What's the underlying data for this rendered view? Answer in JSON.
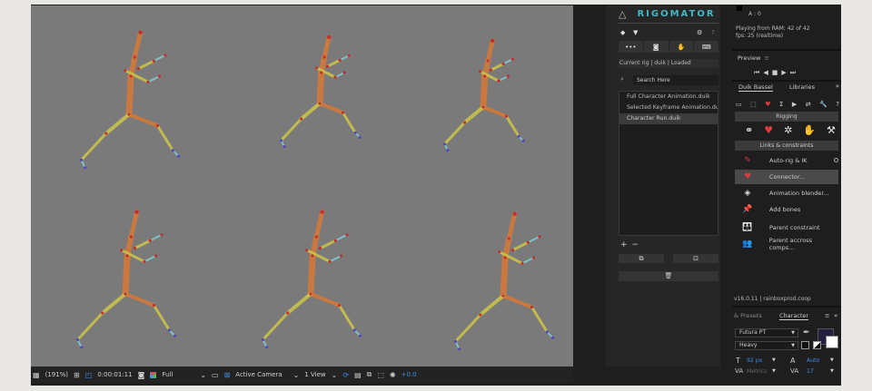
{
  "viewer": {
    "bg_color": "#7a7a7a",
    "status_bar": {
      "zoom": "(191%)",
      "timecode": "0:00:01:11",
      "resolution": "Full",
      "camera": "Active Camera",
      "view": "1 View",
      "exposure": "+0.0"
    }
  },
  "rigomator": {
    "title": "RIGOMATOR",
    "status": "Current rig | duik | Loaded",
    "search_placeholder": "Search Here",
    "items": [
      {
        "label": "Full Character Animation.duik",
        "active": false
      },
      {
        "label": "Selected Keyframe Animation.duik",
        "active": false
      },
      {
        "label": "Character Run.duik",
        "active": true
      }
    ],
    "add_label": "+",
    "remove_label": "−"
  },
  "duik_panel": {
    "alpha_line": "A : 0",
    "ram_status": "Playing from RAM: 42 of 42",
    "fps_status": "fps: 25 (realtime)",
    "preview_title": "Preview",
    "preview_menu": "≡",
    "tabs": [
      {
        "label": "Duik Bassel",
        "active": true
      },
      {
        "label": "Libraries",
        "active": false
      }
    ],
    "sections": {
      "rigging": "Rigging",
      "links": "Links & constraints"
    },
    "tools": [
      {
        "label": "Auto-rig & IK",
        "icon": "auto-rig-icon"
      },
      {
        "label": "Connector...",
        "icon": "connector-icon",
        "selected": true
      },
      {
        "label": "Animation blender...",
        "icon": "animation-blender-icon"
      },
      {
        "label": "Add bones",
        "icon": "pin-icon"
      },
      {
        "label": "Parent constraint",
        "icon": "parent-constraint-icon"
      },
      {
        "label": "Parent accross comps...",
        "icon": "parent-across-icon"
      }
    ],
    "version": "v16.0.11 | rainboxprod.coop",
    "char_tabs": {
      "presets": "& Presets",
      "character": "Character"
    },
    "font_name": "Futura PT",
    "font_style": "Heavy",
    "font_size": "92 px",
    "leading": "Auto",
    "kerning": "Metrics",
    "tracking": "17"
  },
  "colors": {
    "accent_teal": "#43b6c4",
    "duik_red": "#d83c3c",
    "link_blue": "#3a8ee6",
    "bone_yellow": "#c9c24a",
    "bone_orange": "#d2783a",
    "bone_cyan": "#7fc9d2"
  }
}
